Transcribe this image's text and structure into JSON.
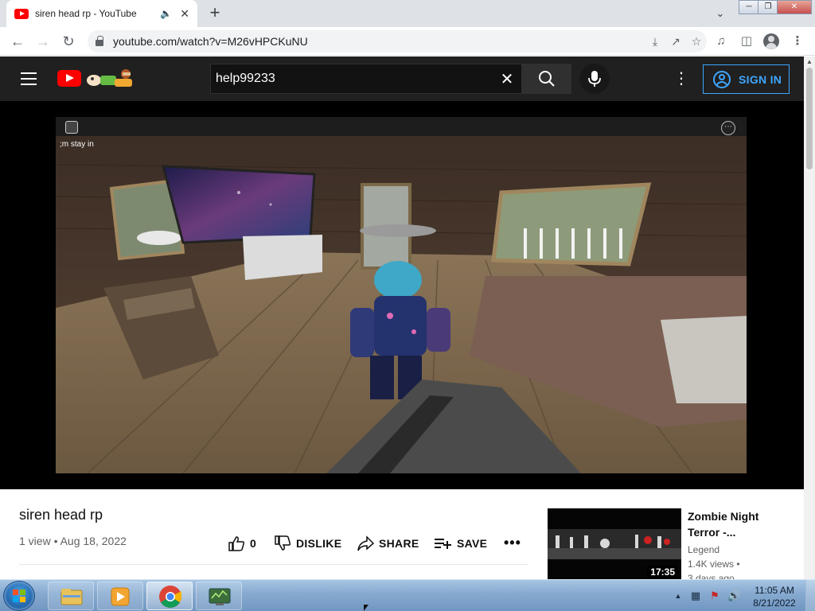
{
  "browser": {
    "tab": {
      "title": "siren head rp - YouTube",
      "audio_icon": "speaker-icon",
      "close_icon": "close-icon"
    },
    "new_tab_icon": "plus-icon",
    "tab_search_icon": "chevron-down-icon",
    "window_controls": [
      "minimize",
      "restore",
      "close"
    ],
    "address": {
      "url": "youtube.com/watch?v=M26vHPCKuNU"
    },
    "toolbar_icons": [
      "install-icon",
      "share-icon",
      "bookmark-star-icon",
      "media-control-icon",
      "side-panel-icon",
      "profile-icon",
      "menu-icon"
    ]
  },
  "youtube": {
    "header": {
      "search": {
        "value": "help99233"
      },
      "signin_label": "SIGN IN"
    },
    "video": {
      "chat_text": ";m stay in",
      "title": "siren head rp",
      "meta": "1 view • Aug 18, 2022",
      "actions": {
        "like_count": "0",
        "dislike_label": "DISLIKE",
        "share_label": "SHARE",
        "save_label": "SAVE",
        "more_label": "•••"
      }
    },
    "recommendation": {
      "title": "Zombie Night Terror -...",
      "channel": "Legend",
      "views": "1.4K views •",
      "age": "3 days ago",
      "duration": "17:35"
    }
  },
  "taskbar": {
    "apps": [
      "explorer",
      "media-player",
      "chrome",
      "network-tool"
    ],
    "clock": {
      "time": "11:05 AM",
      "date": "8/21/2022"
    }
  },
  "colors": {
    "youtube_red": "#ff0000",
    "signin_blue": "#3ea6ff",
    "header_bg": "#202020"
  }
}
